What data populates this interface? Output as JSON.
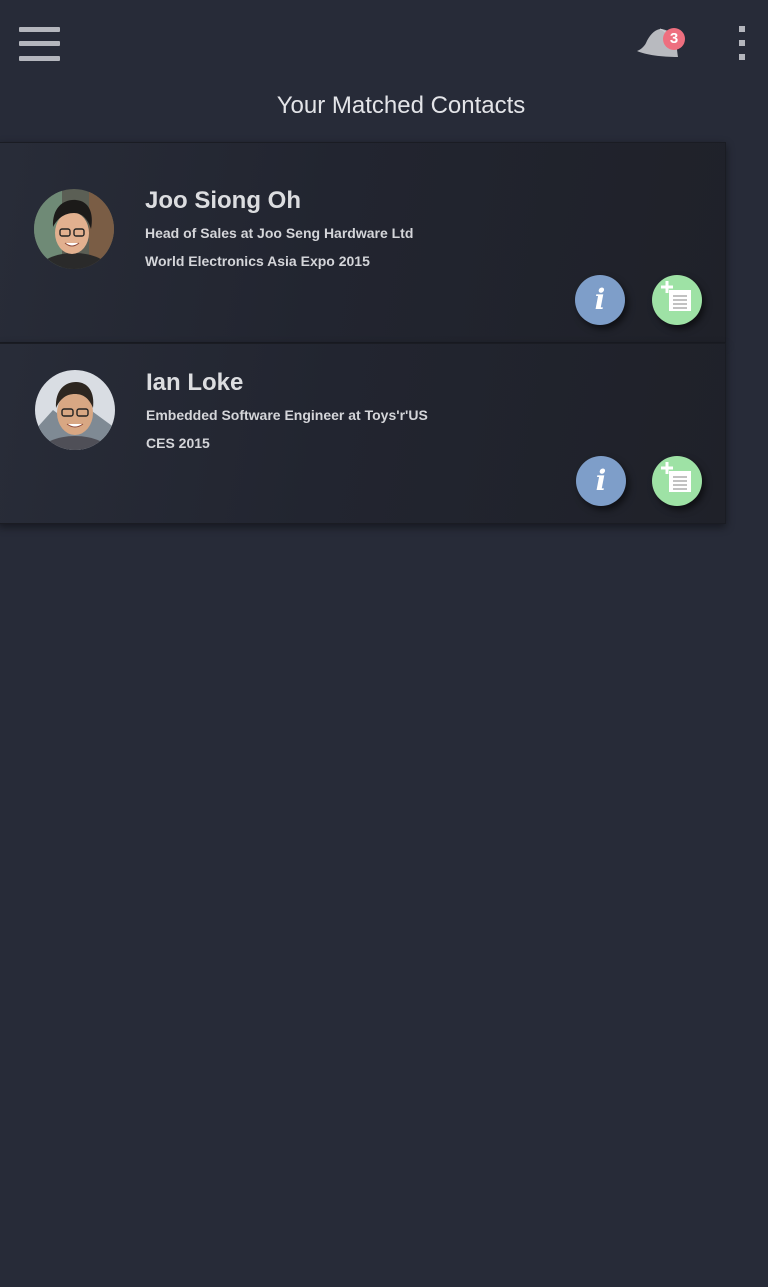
{
  "header": {
    "menu_icon": "hamburger-menu-icon",
    "notification_icon": "bell-icon",
    "notification_count": "3",
    "overflow_icon": "more-vertical-icon"
  },
  "page": {
    "title": "Your Matched Contacts"
  },
  "contacts": [
    {
      "name": "Joo Siong Oh",
      "role": "Head of Sales at Joo Seng Hardware Ltd",
      "event": "World Electronics Asia Expo 2015",
      "info_label": "i",
      "info_icon": "info-icon",
      "add_icon": "add-note-icon"
    },
    {
      "name": "Ian Loke",
      "role": "Embedded Software Engineer at Toys'r'US",
      "event": "CES 2015",
      "info_label": "i",
      "info_icon": "info-icon",
      "add_icon": "add-note-icon"
    }
  ],
  "colors": {
    "background": "#272b38",
    "info_button": "#7e9ec9",
    "add_button": "#9ee2a5",
    "badge": "#ee6f7f"
  }
}
